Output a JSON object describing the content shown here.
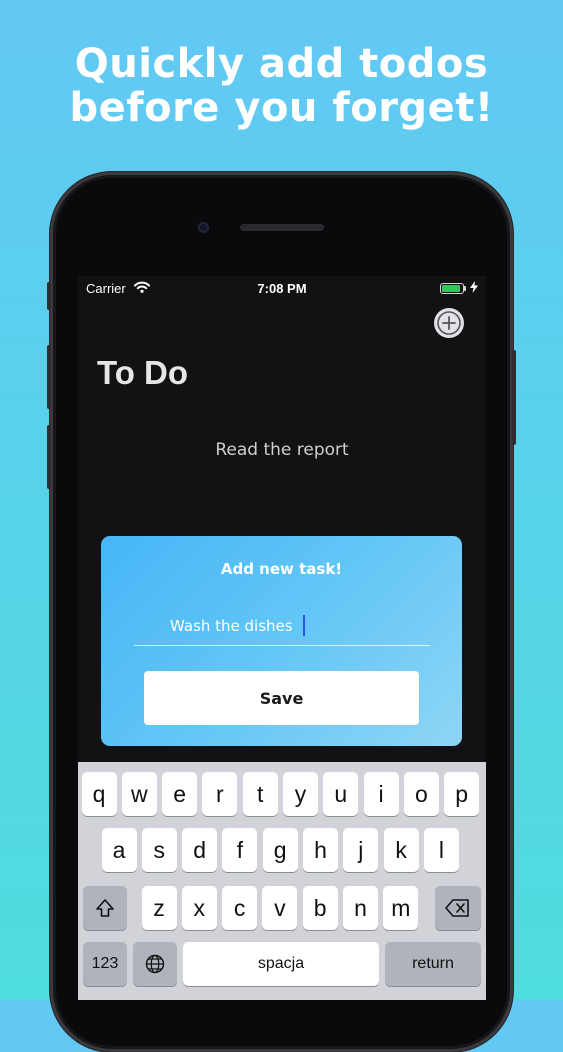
{
  "headline": {
    "line1": "Quickly add todos",
    "line2": "before you forget!"
  },
  "status_bar": {
    "carrier": "Carrier",
    "time": "7:08 PM",
    "battery_level": 0.9
  },
  "app": {
    "title": "To Do",
    "todos": [
      "Read the report"
    ],
    "add_button_icon": "plus-circle-icon"
  },
  "new_task_card": {
    "title": "Add new task!",
    "input_value": "Wash the dishes",
    "save_label": "Save"
  },
  "keyboard": {
    "row1": [
      "q",
      "w",
      "e",
      "r",
      "t",
      "y",
      "u",
      "i",
      "o",
      "p"
    ],
    "row2": [
      "a",
      "s",
      "d",
      "f",
      "g",
      "h",
      "j",
      "k",
      "l"
    ],
    "row3": [
      "z",
      "x",
      "c",
      "v",
      "b",
      "n",
      "m"
    ],
    "numbers_label": "123",
    "space_label": "spacja",
    "return_label": "return",
    "shift_icon": "shift-icon",
    "delete_icon": "backspace-icon",
    "globe_icon": "globe-icon"
  },
  "colors": {
    "background_top": "#62c8f4",
    "background_bottom": "#4fdcdc",
    "app_background": "#121214",
    "card_accent": "#46b6f7",
    "caret": "#2a52e8",
    "battery": "#34c759"
  }
}
